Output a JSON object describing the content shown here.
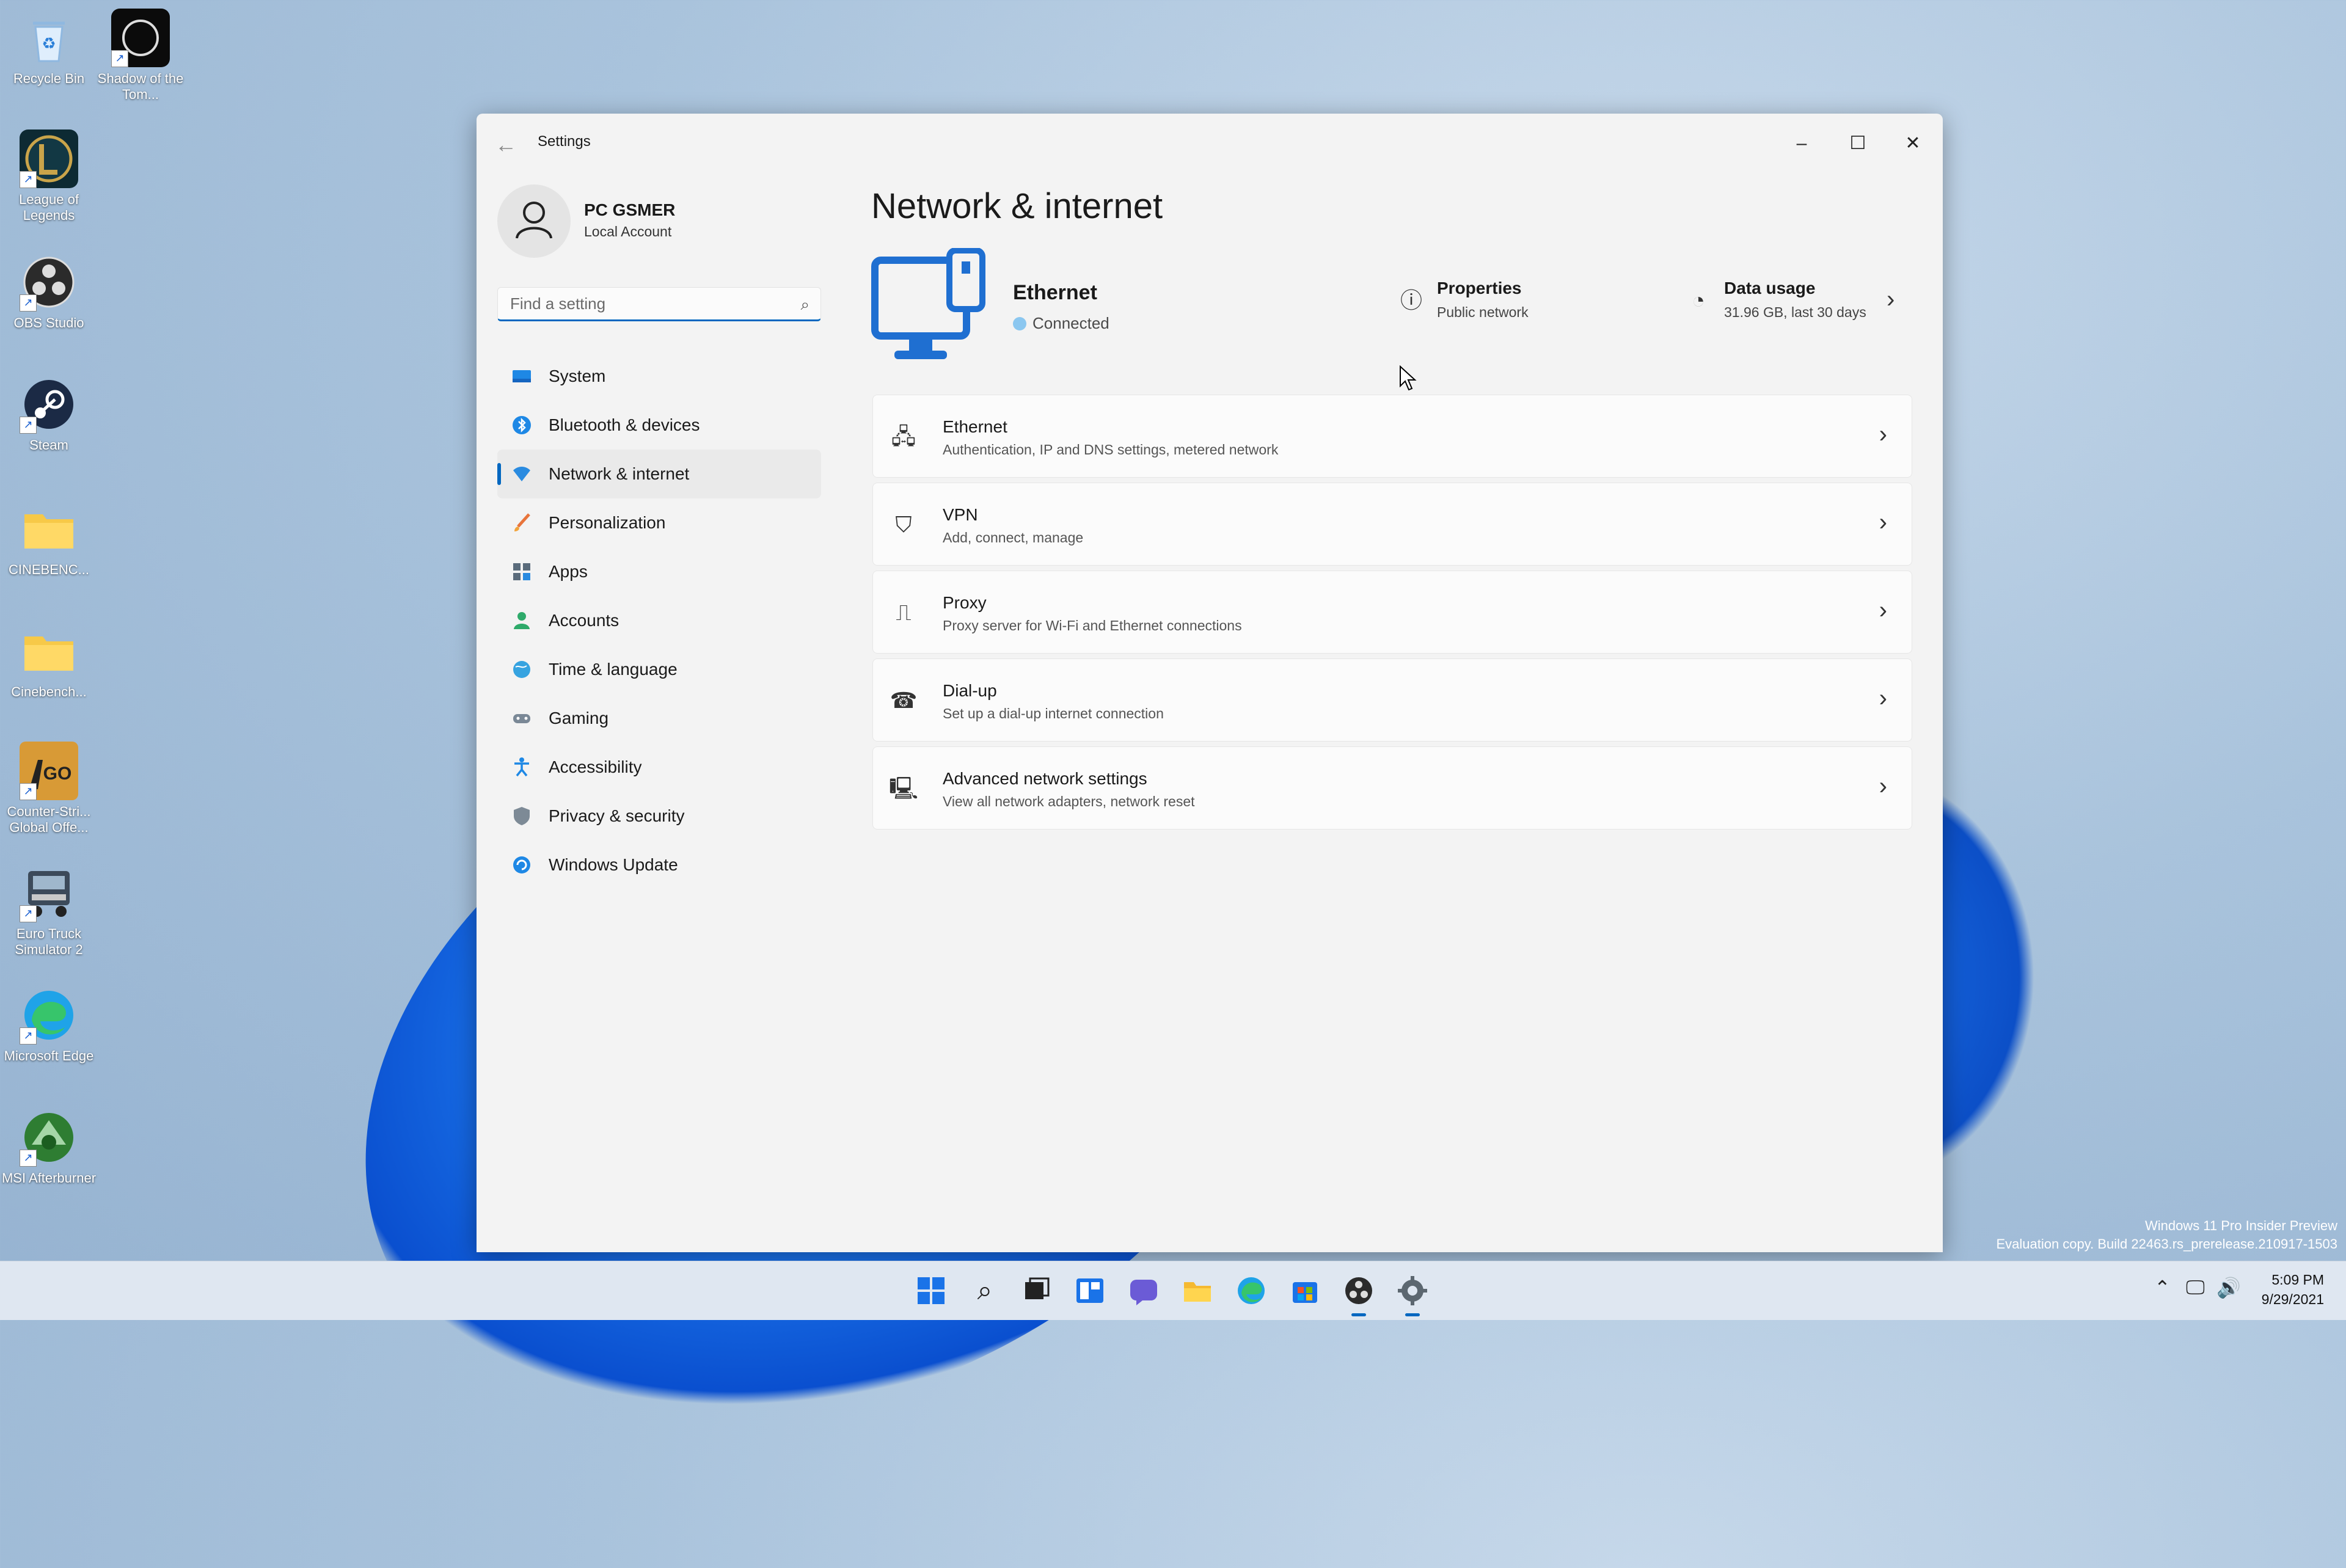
{
  "desktop": {
    "icons": [
      {
        "label": "Recycle Bin",
        "icon": "recycle-bin-icon"
      },
      {
        "label": "Shadow of the Tom...",
        "icon": "shadow-of-the-tomb-raider-icon"
      },
      {
        "label": "League of Legends",
        "icon": "league-of-legends-icon"
      },
      {
        "label": "OBS Studio",
        "icon": "obs-studio-icon"
      },
      {
        "label": "Steam",
        "icon": "steam-icon"
      },
      {
        "label": "CINEBENC...",
        "icon": "folder-icon"
      },
      {
        "label": "Cinebench...",
        "icon": "folder-icon"
      },
      {
        "label": "Counter-Stri... Global Offe...",
        "icon": "counter-strike-icon"
      },
      {
        "label": "Euro Truck Simulator 2",
        "icon": "euro-truck-simulator-icon"
      },
      {
        "label": "Microsoft Edge",
        "icon": "edge-icon"
      },
      {
        "label": "MSI Afterburner",
        "icon": "msi-afterburner-icon"
      }
    ]
  },
  "window": {
    "title": "Settings",
    "back": "←",
    "controls": {
      "minimize": "–",
      "maximize": "☐",
      "close": "✕"
    }
  },
  "profile": {
    "name": "PC GSMER",
    "subtitle": "Local Account"
  },
  "search": {
    "placeholder": "Find a setting"
  },
  "nav": {
    "items": [
      {
        "label": "System",
        "icon": "system-icon"
      },
      {
        "label": "Bluetooth & devices",
        "icon": "bluetooth-icon"
      },
      {
        "label": "Network & internet",
        "icon": "network-icon",
        "active": true
      },
      {
        "label": "Personalization",
        "icon": "brush-icon"
      },
      {
        "label": "Apps",
        "icon": "apps-icon"
      },
      {
        "label": "Accounts",
        "icon": "accounts-icon"
      },
      {
        "label": "Time & language",
        "icon": "globe-icon"
      },
      {
        "label": "Gaming",
        "icon": "gamepad-icon"
      },
      {
        "label": "Accessibility",
        "icon": "accessibility-icon"
      },
      {
        "label": "Privacy & security",
        "icon": "shield-icon"
      },
      {
        "label": "Windows Update",
        "icon": "update-icon"
      }
    ]
  },
  "page": {
    "title": "Network & internet"
  },
  "hero": {
    "name": "Ethernet",
    "status": "Connected",
    "properties": {
      "title": "Properties",
      "subtitle": "Public network"
    },
    "data_usage": {
      "title": "Data usage",
      "subtitle": "31.96 GB, last 30 days"
    }
  },
  "cards": [
    {
      "title": "Ethernet",
      "subtitle": "Authentication, IP and DNS settings, metered network",
      "icon": "ethernet-icon"
    },
    {
      "title": "VPN",
      "subtitle": "Add, connect, manage",
      "icon": "vpn-shield-icon"
    },
    {
      "title": "Proxy",
      "subtitle": "Proxy server for Wi-Fi and Ethernet connections",
      "icon": "proxy-icon"
    },
    {
      "title": "Dial-up",
      "subtitle": "Set up a dial-up internet connection",
      "icon": "dial-up-icon"
    },
    {
      "title": "Advanced network settings",
      "subtitle": "View all network adapters, network reset",
      "icon": "advanced-network-icon"
    }
  ],
  "watermark": {
    "line1": "Windows 11 Pro Insider Preview",
    "line2": "Evaluation copy. Build 22463.rs_prerelease.210917-1503"
  },
  "taskbar": {
    "time": "5:09 PM",
    "date": "9/29/2021"
  },
  "colors": {
    "accent": "#0067c0"
  }
}
